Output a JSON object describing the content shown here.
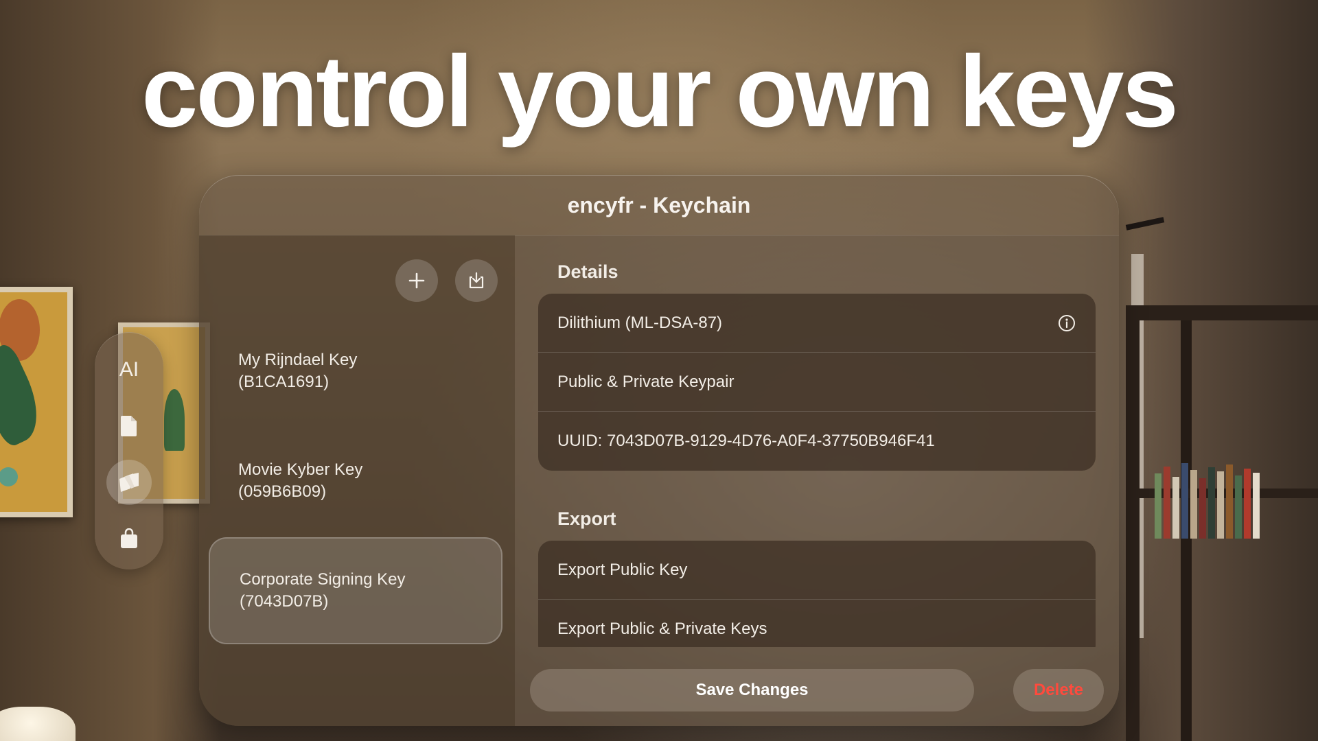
{
  "headline": "control your own keys",
  "window": {
    "title": "encyfr - Keychain"
  },
  "ornament": {
    "tabs": [
      {
        "icon": "text-format-icon",
        "label": "AI",
        "active": false
      },
      {
        "icon": "document-icon",
        "active": false
      },
      {
        "icon": "keychain-icon",
        "active": true
      },
      {
        "icon": "shopping-bag-icon",
        "active": false
      }
    ]
  },
  "sidebar": {
    "add_icon": "plus-icon",
    "import_icon": "import-icon",
    "keys": [
      {
        "line1": "My Rijndael Key",
        "line2": "(B1CA1691)",
        "selected": false
      },
      {
        "line1": "Movie Kyber Key",
        "line2": "(059B6B09)",
        "selected": false
      },
      {
        "line1": "Corporate Signing Key",
        "line2": "(7043D07B)",
        "selected": true
      }
    ]
  },
  "details": {
    "section_title": "Details",
    "rows": [
      {
        "text": "Dilithium (ML-DSA-87)",
        "icon": "info-icon"
      },
      {
        "text": "Public & Private Keypair"
      },
      {
        "text": "UUID: 7043D07B-9129-4D76-A0F4-37750B946F41"
      }
    ]
  },
  "export": {
    "section_title": "Export",
    "rows": [
      {
        "text": "Export Public Key"
      },
      {
        "text": "Export Public & Private Keys"
      }
    ]
  },
  "actions": {
    "save_label": "Save Changes",
    "delete_label": "Delete",
    "delete_color": "#ff4a3d"
  }
}
